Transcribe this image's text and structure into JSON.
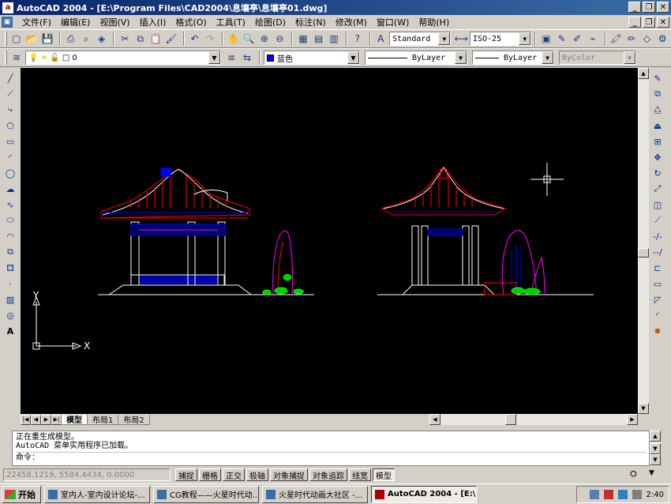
{
  "window": {
    "title": "AutoCAD 2004 - [E:\\Program Files\\CAD2004\\息壤亭\\息壤亭01.dwg]",
    "app_icon_letter": "a"
  },
  "menu": [
    "文件(F)",
    "编辑(E)",
    "视图(V)",
    "插入(I)",
    "格式(O)",
    "工具(T)",
    "绘图(D)",
    "标注(N)",
    "修改(M)",
    "窗口(W)",
    "帮助(H)"
  ],
  "toolbar": {
    "text_style": "Standard",
    "dim_style": "ISO-25"
  },
  "properties": {
    "layer": "0",
    "color": "蓝色",
    "color_hex": "#0000ff",
    "linetype": "ByLayer",
    "lineweight": "ByLayer",
    "plot_style": "ByColor"
  },
  "canvas": {
    "background": "#000000",
    "ucs_x": "X",
    "ucs_y": "Y"
  },
  "layout_tabs": [
    "模型",
    "布局1",
    "布局2"
  ],
  "command": {
    "lines": [
      "正在重生成模型。",
      "AutoCAD 菜单实用程序已加载。"
    ],
    "prompt": "命令："
  },
  "status": {
    "coordinates": "22458.1219, 5584.4434, 0.0000",
    "buttons": [
      {
        "label": "捕捉",
        "on": false
      },
      {
        "label": "栅格",
        "on": false
      },
      {
        "label": "正交",
        "on": false
      },
      {
        "label": "极轴",
        "on": false
      },
      {
        "label": "对象捕捉",
        "on": false
      },
      {
        "label": "对象追踪",
        "on": false
      },
      {
        "label": "线宽",
        "on": false
      },
      {
        "label": "模型",
        "on": true
      }
    ]
  },
  "taskbar": {
    "start": "开始",
    "tasks": [
      {
        "label": "室内人-室内设计论坛-...",
        "active": false
      },
      {
        "label": "CG教程——火星时代动...",
        "active": false
      },
      {
        "label": "火星时代动画大社区 -...",
        "active": false
      },
      {
        "label": "AutoCAD 2004 - [E:\\Pro...",
        "active": true
      }
    ],
    "clock": "2:40"
  }
}
